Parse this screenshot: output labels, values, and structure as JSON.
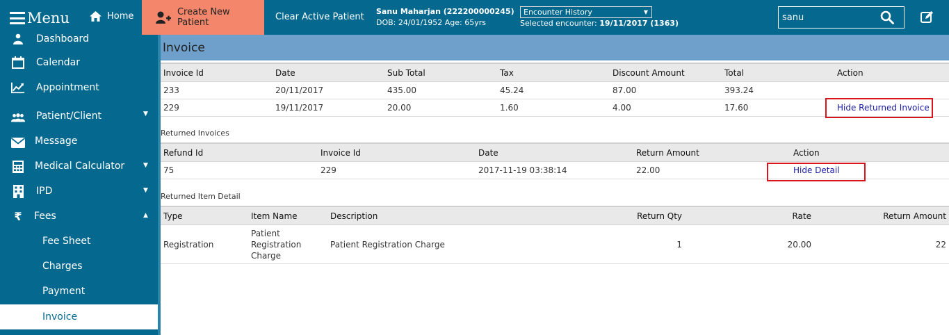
{
  "topbar": {
    "menu_label": "Menu",
    "home_label": "Home",
    "create_patient_label": "Create New Patient",
    "clear_patient_label": "Clear Active Patient",
    "patient_name": "Sanu Maharjan (222200000245)",
    "patient_details": "DOB: 24/01/1952 Age: 65yrs",
    "encounter_select": "Encounter History",
    "selected_encounter_label": "Selected encounter:",
    "selected_encounter_value": "19/11/2017 (1363)",
    "search_value": "sanu",
    "colors": {
      "bar": "#05698f",
      "create_button": "#f4876b"
    }
  },
  "sidebar": {
    "items": [
      {
        "label": "Dashboard",
        "icon": "dashboard-icon"
      },
      {
        "label": "Calendar",
        "icon": "calendar-icon"
      },
      {
        "label": "Appointment",
        "icon": "chart-line-icon"
      },
      {
        "label": "Patient/Client",
        "icon": "users-icon",
        "caret": "down"
      },
      {
        "label": "Message",
        "icon": "envelope-icon"
      },
      {
        "label": "Medical Calculator",
        "icon": "calculator-icon",
        "caret": "down"
      },
      {
        "label": "IPD",
        "icon": "building-icon",
        "caret": "down"
      },
      {
        "label": "Fees",
        "icon": "rupee-icon",
        "caret": "up"
      }
    ],
    "fees_sub": [
      {
        "label": "Fee Sheet"
      },
      {
        "label": "Charges"
      },
      {
        "label": "Payment"
      },
      {
        "label": "Invoice",
        "active": true
      }
    ]
  },
  "page": {
    "title": "Invoice"
  },
  "invoices": {
    "headers": [
      "Invoice Id",
      "Date",
      "Sub Total",
      "Tax",
      "Discount Amount",
      "Total",
      "Action"
    ],
    "rows": [
      {
        "id": "233",
        "date": "20/11/2017",
        "subtotal": "435.00",
        "tax": "45.24",
        "discount": "87.00",
        "total": "393.24",
        "action": ""
      },
      {
        "id": "229",
        "date": "19/11/2017",
        "subtotal": "20.00",
        "tax": "1.60",
        "discount": "4.00",
        "total": "17.60",
        "action": "Hide Returned Invoice"
      }
    ]
  },
  "returned_invoices": {
    "title": "Returned Invoices",
    "headers": [
      "Refund Id",
      "Invoice Id",
      "Date",
      "Return Amount",
      "Action"
    ],
    "rows": [
      {
        "refund_id": "75",
        "invoice_id": "229",
        "date": "2017-11-19 03:38:14",
        "amount": "22.00",
        "action": "Hide Detail"
      }
    ]
  },
  "returned_items": {
    "title": "Returned Item Detail",
    "headers": [
      "Type",
      "Item Name",
      "Description",
      "Return Qty",
      "Rate",
      "Return Amount"
    ],
    "rows": [
      {
        "type": "Registration",
        "item_name": "Patient Registration Charge",
        "description": "Patient Registration Charge",
        "qty": "1",
        "rate": "20.00",
        "amount": "22"
      }
    ]
  }
}
